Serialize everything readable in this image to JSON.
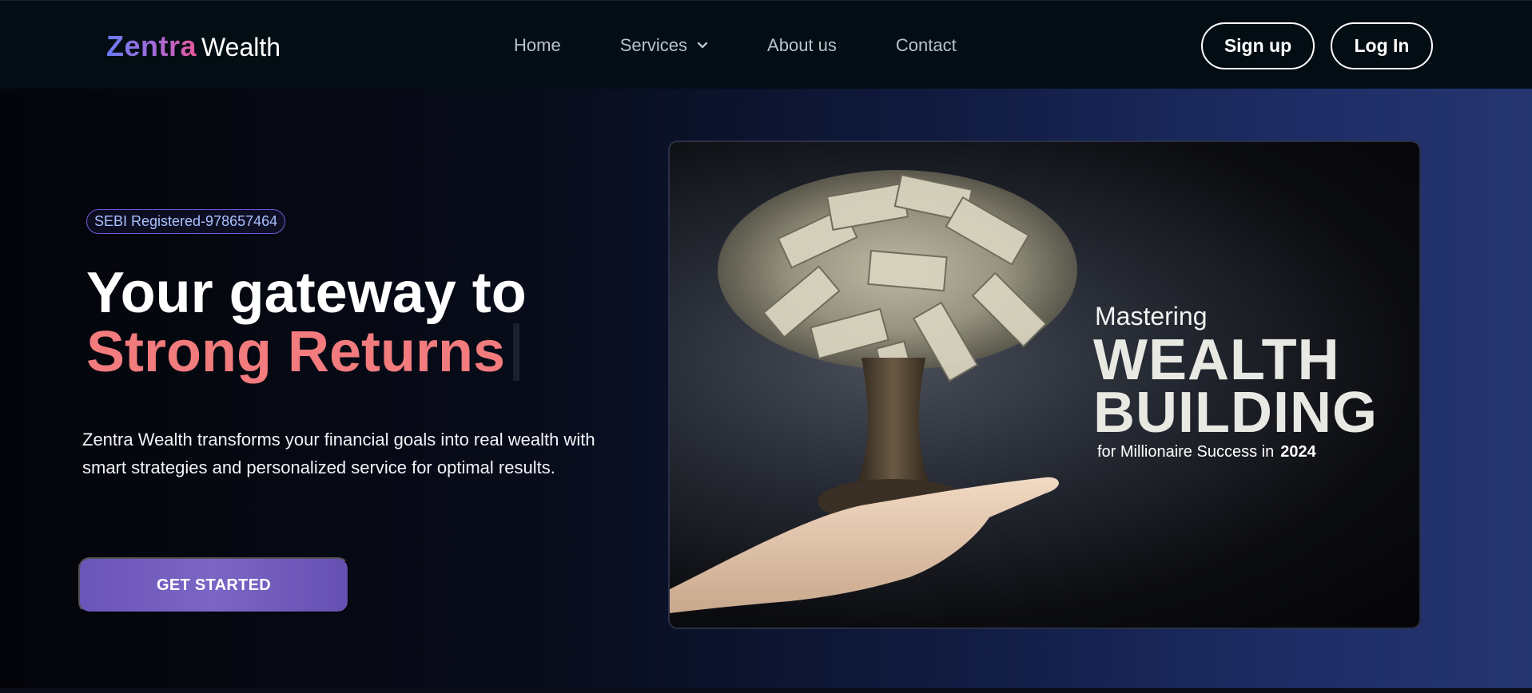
{
  "brand": {
    "name_part1": "Zentra",
    "name_part2": "Wealth"
  },
  "nav": {
    "items": [
      {
        "label": "Home"
      },
      {
        "label": "Services"
      },
      {
        "label": "About us"
      },
      {
        "label": "Contact"
      }
    ],
    "signup_label": "Sign up",
    "login_label": "Log In"
  },
  "hero": {
    "badge": "SEBI Registered-978657464",
    "headline_line1": "Your gateway to",
    "headline_line2": "Strong Returns",
    "description": "Zentra Wealth transforms your financial goals into real wealth with smart strategies and personalized service for optimal results.",
    "cta_label": "GET STARTED"
  },
  "promo": {
    "line1": "Mastering",
    "line2a": "WEALTH",
    "line2b": "BUILDING",
    "line3": "for Millionaire Success in",
    "year": "2024"
  },
  "icons": {
    "services_dropdown": "chevron-down-icon"
  },
  "colors": {
    "navbar_bg": "#030d14",
    "accent_pink": "#f17b7d",
    "cta_purple": "#6a55b8",
    "badge_border": "#6f5bd6"
  }
}
